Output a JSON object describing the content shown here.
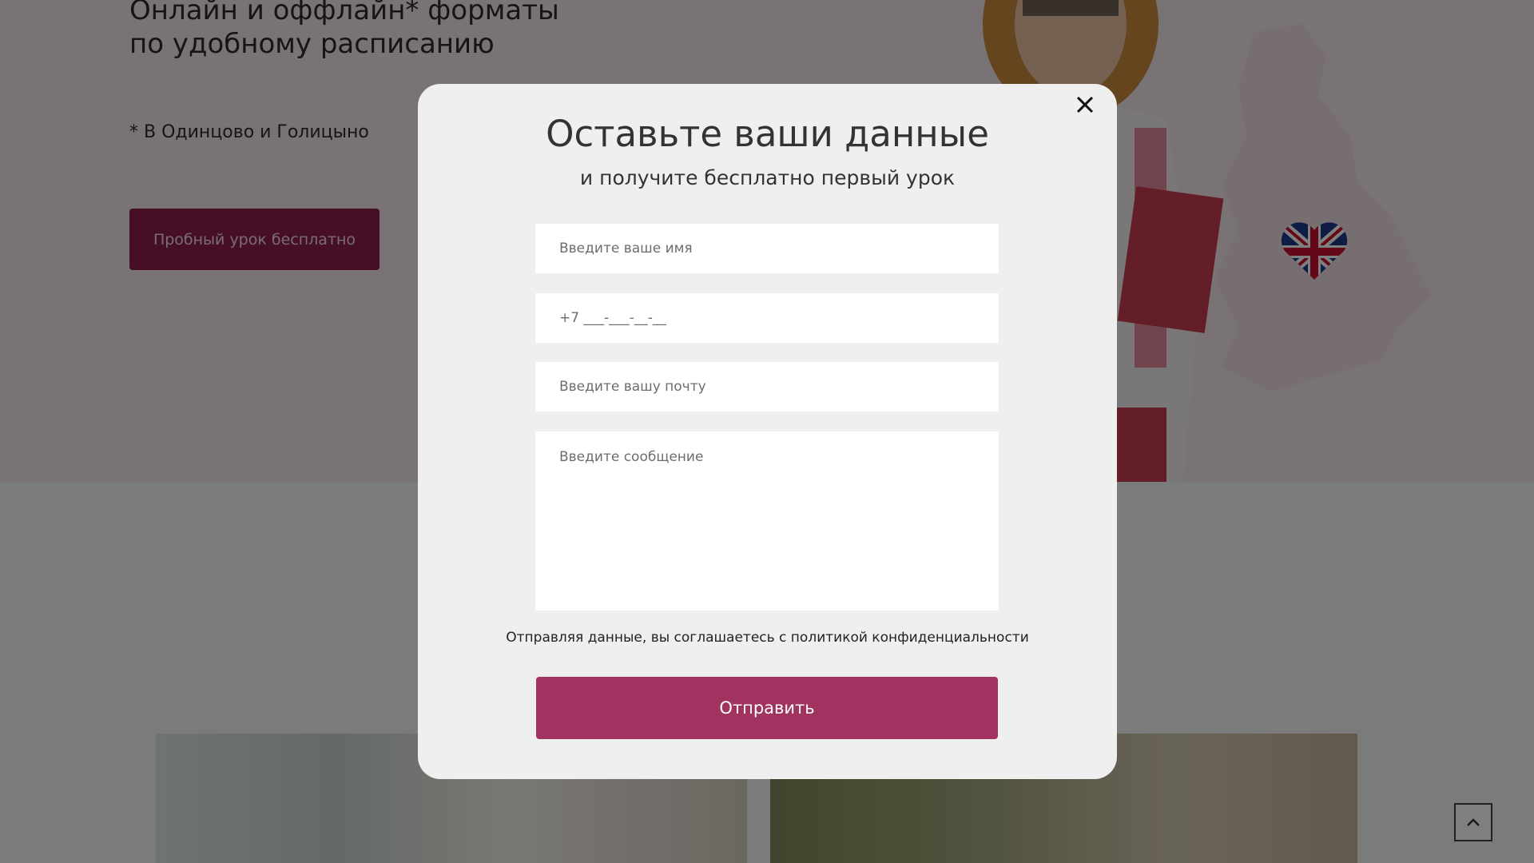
{
  "hero": {
    "title_line1": "Онлайн и оффлайн* форматы",
    "title_line2": "по удобному расписанию",
    "note": "* В Одинцово и Голицыно",
    "trial_button": "Пробный урок бесплатно"
  },
  "modal": {
    "title": "Оставьте ваши данные",
    "subtitle": "и получите бесплатно первый урок",
    "name_placeholder": "Введите ваше имя",
    "phone_placeholder": "+7 ___-___-__-__",
    "email_placeholder": "Введите вашу почту",
    "message_placeholder": "Введите сообщение",
    "consent": "Отправляя данные, вы соглашаетесь с политикой конфиденциальности",
    "submit_label": "Отправить",
    "close_icon": "close-icon"
  },
  "icons": {
    "scroll_top": "chevron-up-icon",
    "flag": "uk-flag-heart-icon"
  },
  "colors": {
    "brand": "#a2325f",
    "brand_dark": "#8d1f4d",
    "hero_bg": "#f4e7ec",
    "overlay": "rgba(0,0,0,0.5)"
  }
}
